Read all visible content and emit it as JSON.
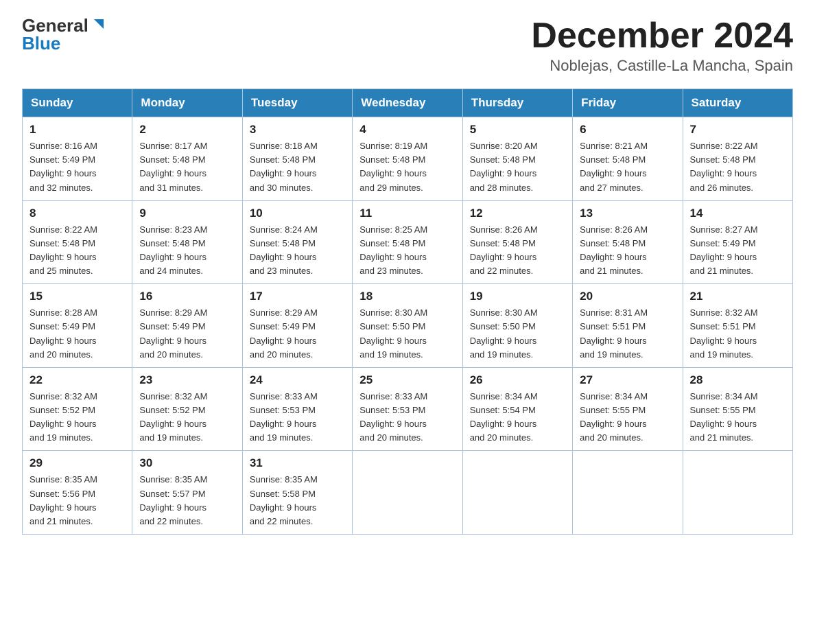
{
  "logo": {
    "general": "General",
    "blue": "Blue"
  },
  "header": {
    "month": "December 2024",
    "location": "Noblejas, Castille-La Mancha, Spain"
  },
  "weekdays": [
    "Sunday",
    "Monday",
    "Tuesday",
    "Wednesday",
    "Thursday",
    "Friday",
    "Saturday"
  ],
  "weeks": [
    [
      {
        "day": "1",
        "sunrise": "8:16 AM",
        "sunset": "5:49 PM",
        "daylight": "9 hours and 32 minutes."
      },
      {
        "day": "2",
        "sunrise": "8:17 AM",
        "sunset": "5:48 PM",
        "daylight": "9 hours and 31 minutes."
      },
      {
        "day": "3",
        "sunrise": "8:18 AM",
        "sunset": "5:48 PM",
        "daylight": "9 hours and 30 minutes."
      },
      {
        "day": "4",
        "sunrise": "8:19 AM",
        "sunset": "5:48 PM",
        "daylight": "9 hours and 29 minutes."
      },
      {
        "day": "5",
        "sunrise": "8:20 AM",
        "sunset": "5:48 PM",
        "daylight": "9 hours and 28 minutes."
      },
      {
        "day": "6",
        "sunrise": "8:21 AM",
        "sunset": "5:48 PM",
        "daylight": "9 hours and 27 minutes."
      },
      {
        "day": "7",
        "sunrise": "8:22 AM",
        "sunset": "5:48 PM",
        "daylight": "9 hours and 26 minutes."
      }
    ],
    [
      {
        "day": "8",
        "sunrise": "8:22 AM",
        "sunset": "5:48 PM",
        "daylight": "9 hours and 25 minutes."
      },
      {
        "day": "9",
        "sunrise": "8:23 AM",
        "sunset": "5:48 PM",
        "daylight": "9 hours and 24 minutes."
      },
      {
        "day": "10",
        "sunrise": "8:24 AM",
        "sunset": "5:48 PM",
        "daylight": "9 hours and 23 minutes."
      },
      {
        "day": "11",
        "sunrise": "8:25 AM",
        "sunset": "5:48 PM",
        "daylight": "9 hours and 23 minutes."
      },
      {
        "day": "12",
        "sunrise": "8:26 AM",
        "sunset": "5:48 PM",
        "daylight": "9 hours and 22 minutes."
      },
      {
        "day": "13",
        "sunrise": "8:26 AM",
        "sunset": "5:48 PM",
        "daylight": "9 hours and 21 minutes."
      },
      {
        "day": "14",
        "sunrise": "8:27 AM",
        "sunset": "5:49 PM",
        "daylight": "9 hours and 21 minutes."
      }
    ],
    [
      {
        "day": "15",
        "sunrise": "8:28 AM",
        "sunset": "5:49 PM",
        "daylight": "9 hours and 20 minutes."
      },
      {
        "day": "16",
        "sunrise": "8:29 AM",
        "sunset": "5:49 PM",
        "daylight": "9 hours and 20 minutes."
      },
      {
        "day": "17",
        "sunrise": "8:29 AM",
        "sunset": "5:49 PM",
        "daylight": "9 hours and 20 minutes."
      },
      {
        "day": "18",
        "sunrise": "8:30 AM",
        "sunset": "5:50 PM",
        "daylight": "9 hours and 19 minutes."
      },
      {
        "day": "19",
        "sunrise": "8:30 AM",
        "sunset": "5:50 PM",
        "daylight": "9 hours and 19 minutes."
      },
      {
        "day": "20",
        "sunrise": "8:31 AM",
        "sunset": "5:51 PM",
        "daylight": "9 hours and 19 minutes."
      },
      {
        "day": "21",
        "sunrise": "8:32 AM",
        "sunset": "5:51 PM",
        "daylight": "9 hours and 19 minutes."
      }
    ],
    [
      {
        "day": "22",
        "sunrise": "8:32 AM",
        "sunset": "5:52 PM",
        "daylight": "9 hours and 19 minutes."
      },
      {
        "day": "23",
        "sunrise": "8:32 AM",
        "sunset": "5:52 PM",
        "daylight": "9 hours and 19 minutes."
      },
      {
        "day": "24",
        "sunrise": "8:33 AM",
        "sunset": "5:53 PM",
        "daylight": "9 hours and 19 minutes."
      },
      {
        "day": "25",
        "sunrise": "8:33 AM",
        "sunset": "5:53 PM",
        "daylight": "9 hours and 20 minutes."
      },
      {
        "day": "26",
        "sunrise": "8:34 AM",
        "sunset": "5:54 PM",
        "daylight": "9 hours and 20 minutes."
      },
      {
        "day": "27",
        "sunrise": "8:34 AM",
        "sunset": "5:55 PM",
        "daylight": "9 hours and 20 minutes."
      },
      {
        "day": "28",
        "sunrise": "8:34 AM",
        "sunset": "5:55 PM",
        "daylight": "9 hours and 21 minutes."
      }
    ],
    [
      {
        "day": "29",
        "sunrise": "8:35 AM",
        "sunset": "5:56 PM",
        "daylight": "9 hours and 21 minutes."
      },
      {
        "day": "30",
        "sunrise": "8:35 AM",
        "sunset": "5:57 PM",
        "daylight": "9 hours and 22 minutes."
      },
      {
        "day": "31",
        "sunrise": "8:35 AM",
        "sunset": "5:58 PM",
        "daylight": "9 hours and 22 minutes."
      },
      null,
      null,
      null,
      null
    ]
  ],
  "labels": {
    "sunrise": "Sunrise:",
    "sunset": "Sunset:",
    "daylight": "Daylight:"
  }
}
